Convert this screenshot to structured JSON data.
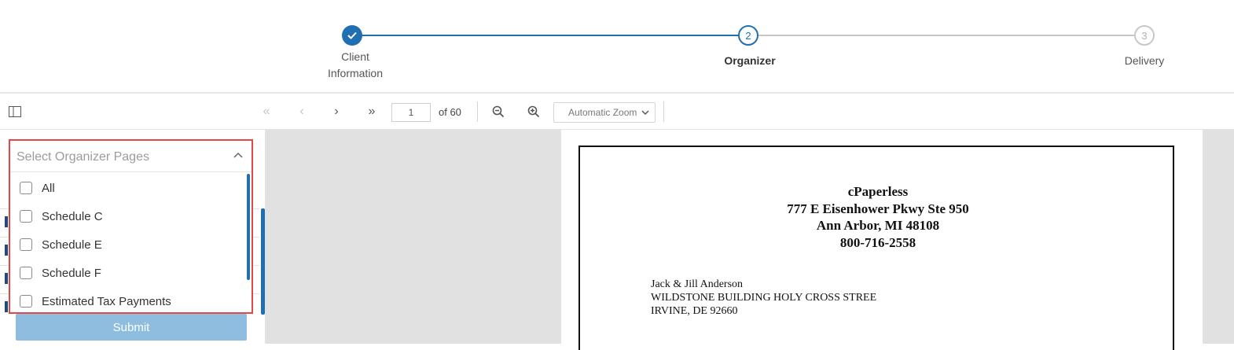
{
  "stepper": {
    "steps": [
      {
        "label_line1": "Client",
        "label_line2": "Information",
        "state": "complete"
      },
      {
        "number": "2",
        "label": "Organizer",
        "state": "active"
      },
      {
        "number": "3",
        "label": "Delivery",
        "state": "pending"
      }
    ],
    "colors": {
      "active": "#1f6fb2",
      "pending": "#c8c8c8"
    }
  },
  "toolbar": {
    "sidebar_toggle_icon": "sidebar-toggle-icon",
    "first_page_icon": "double-chevron-left-icon",
    "prev_page_icon": "chevron-left-icon",
    "next_page_icon": "chevron-right-icon",
    "last_page_icon": "double-chevron-right-icon",
    "page_number": "1",
    "page_total": "of 60",
    "zoom_out_icon": "zoom-out-icon",
    "zoom_in_icon": "zoom-in-icon",
    "zoom_value": "Automatic Zoom"
  },
  "organizer_select": {
    "placeholder": "Select Organizer Pages",
    "options": [
      {
        "label": "All",
        "checked": false
      },
      {
        "label": "Schedule C",
        "checked": false
      },
      {
        "label": "Schedule E",
        "checked": false
      },
      {
        "label": "Schedule F",
        "checked": false
      },
      {
        "label": "Estimated Tax Payments",
        "checked": false
      }
    ],
    "highlight_color": "#e24848"
  },
  "submit": {
    "label": "Submit",
    "color": "#8fbde0"
  },
  "document": {
    "firm_name": "cPaperless",
    "firm_address1": "777 E Eisenhower Pkwy Ste 950",
    "firm_address2": "Ann Arbor, MI 48108",
    "firm_phone": "800-716-2558",
    "client_name": "Jack & Jill Anderson",
    "client_address1": "WILDSTONE BUILDING HOLY CROSS STREE",
    "client_address2": "IRVINE, DE  92660"
  }
}
